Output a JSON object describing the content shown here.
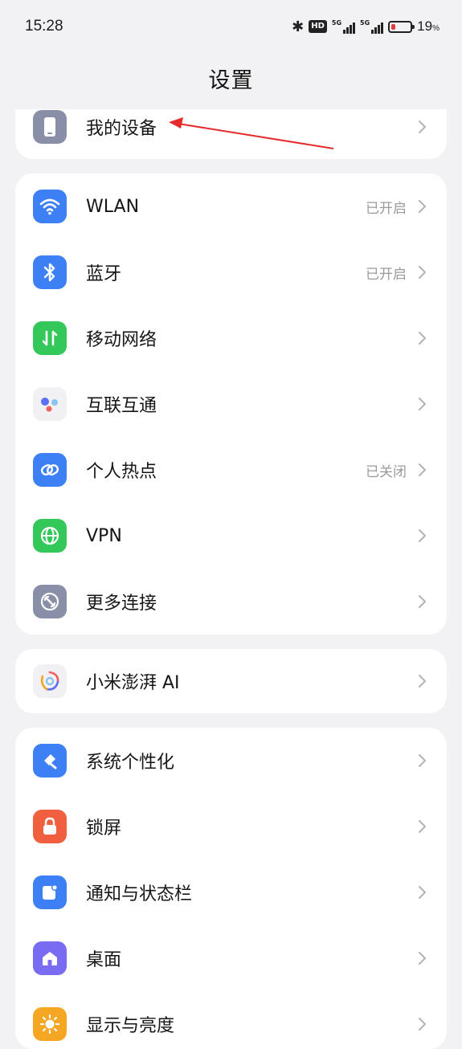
{
  "status_bar": {
    "time": "15:28",
    "hd": "HD",
    "sim1": "5G",
    "sim2": "5G",
    "battery_percent": "19",
    "battery_unit": "%",
    "battery_color": "#e23b3b"
  },
  "header": {
    "title": "设置"
  },
  "groups": {
    "device": {
      "items": [
        {
          "label": "我的设备",
          "status": "",
          "icon": "phone-icon"
        }
      ]
    },
    "connectivity": {
      "items": [
        {
          "label": "WLAN",
          "status": "已开启",
          "icon": "wifi-icon",
          "color": "#3d7ff5"
        },
        {
          "label": "蓝牙",
          "status": "已开启",
          "icon": "bluetooth-icon",
          "color": "#3d7ff5"
        },
        {
          "label": "移动网络",
          "status": "",
          "icon": "mobile-data-icon",
          "color": "#34c759"
        },
        {
          "label": "互联互通",
          "status": "",
          "icon": "interconnect-icon"
        },
        {
          "label": "个人热点",
          "status": "已关闭",
          "icon": "hotspot-icon",
          "color": "#3d7ff5"
        },
        {
          "label": "VPN",
          "status": "",
          "icon": "globe-icon",
          "color": "#34c759"
        },
        {
          "label": "更多连接",
          "status": "",
          "icon": "link-icon",
          "color": "#8a8fa8"
        }
      ]
    },
    "ai": {
      "items": [
        {
          "label": "小米澎湃 AI",
          "status": "",
          "icon": "hyper-ai-icon"
        }
      ]
    },
    "personalization": {
      "items": [
        {
          "label": "系统个性化",
          "status": "",
          "icon": "brush-icon",
          "color": "#3d7ff5"
        },
        {
          "label": "锁屏",
          "status": "",
          "icon": "lock-icon",
          "color": "#f0603e"
        },
        {
          "label": "通知与状态栏",
          "status": "",
          "icon": "notification-icon",
          "color": "#3d7ff5"
        },
        {
          "label": "桌面",
          "status": "",
          "icon": "home-icon",
          "color": "#7a6cf2"
        },
        {
          "label": "显示与亮度",
          "status": "",
          "icon": "sun-icon",
          "color": "#f5a623"
        }
      ]
    }
  }
}
